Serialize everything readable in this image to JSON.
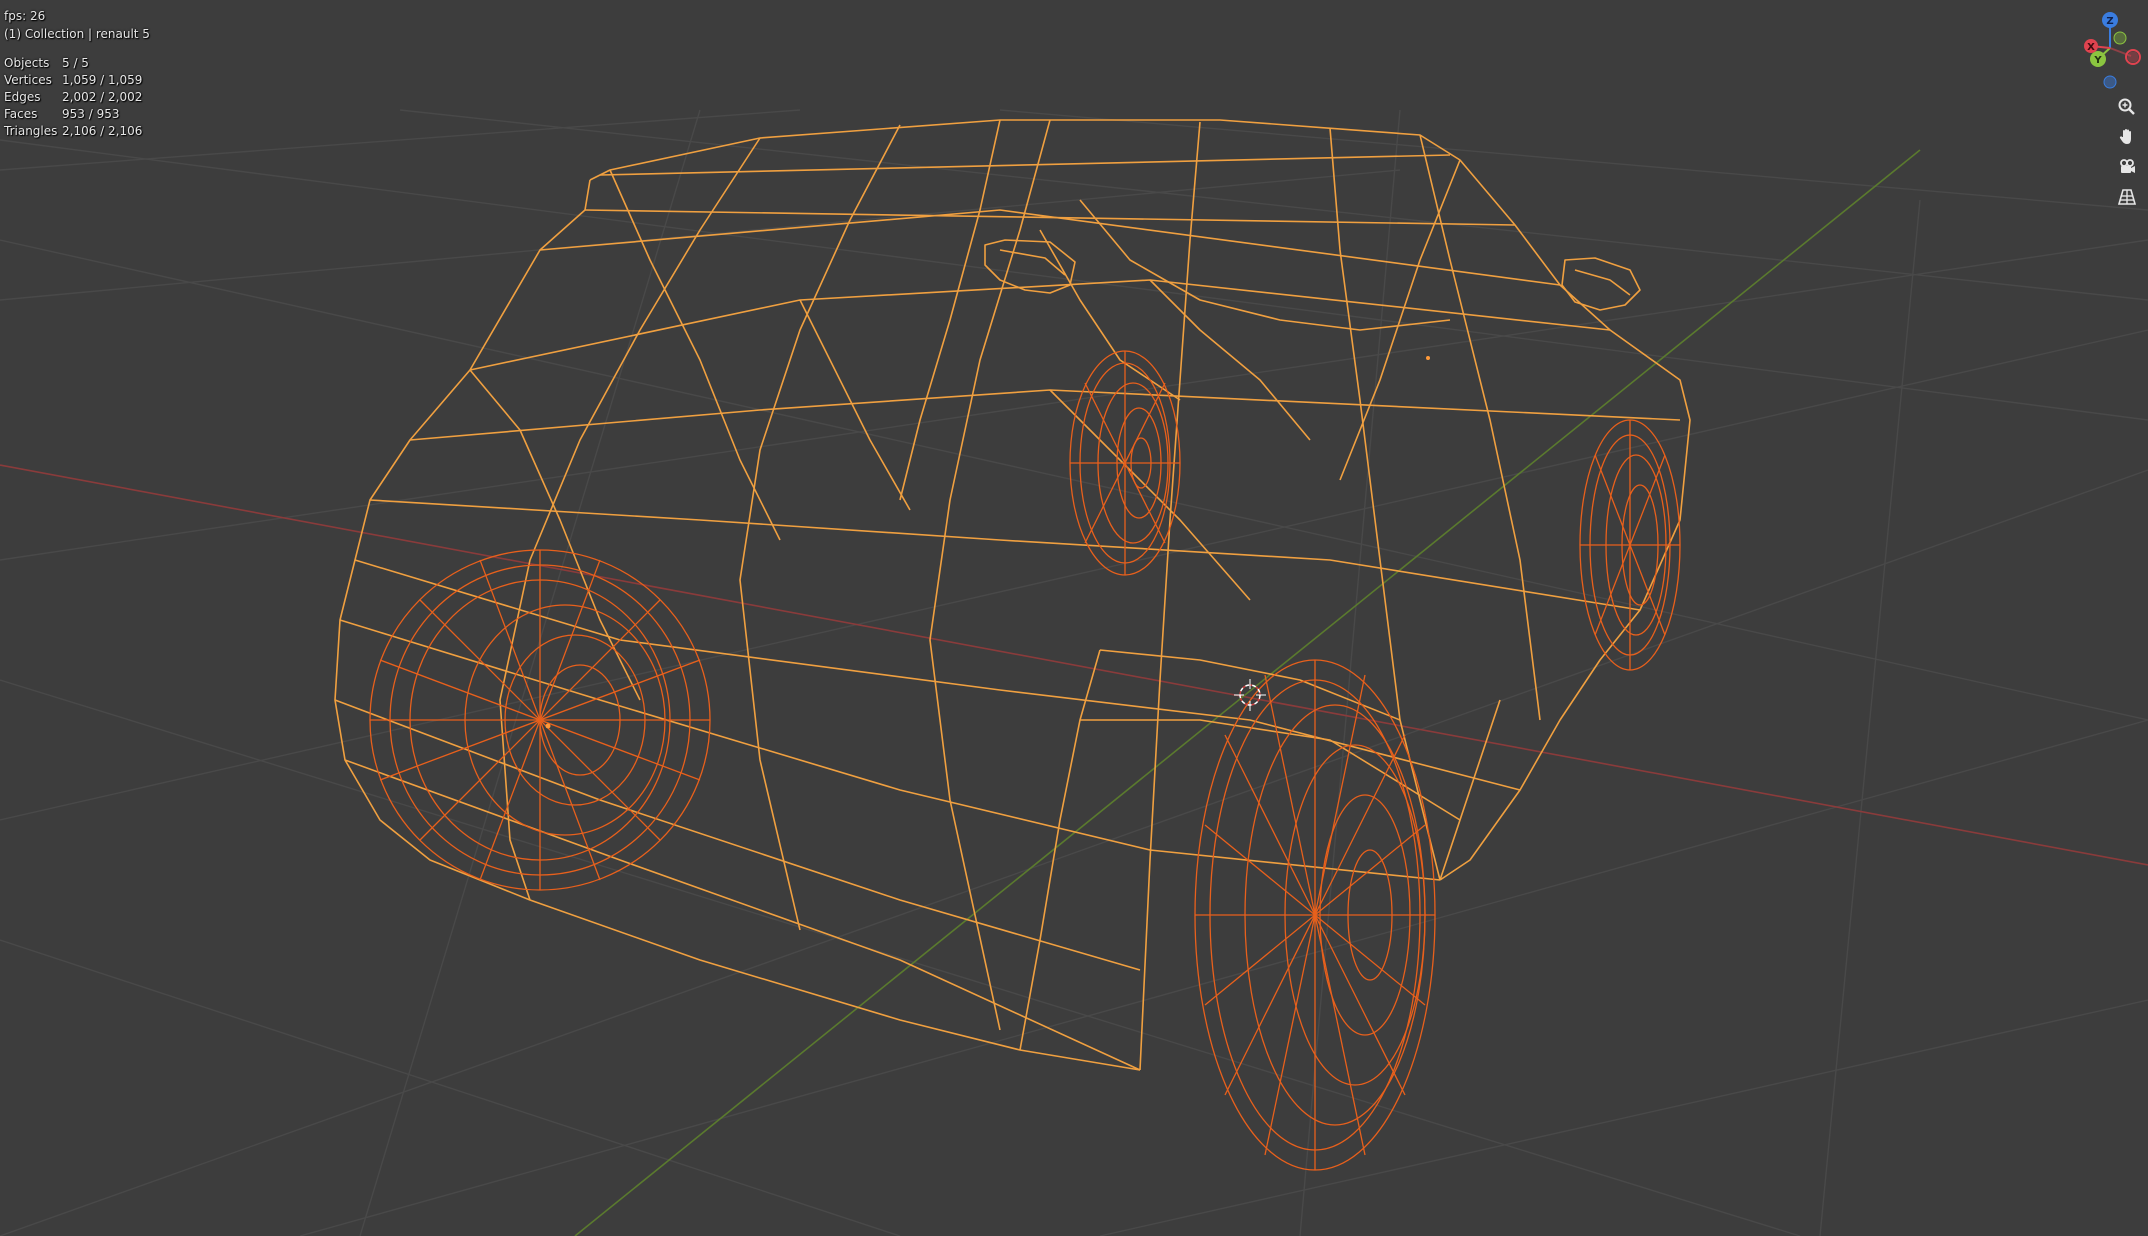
{
  "overlay": {
    "fps": "fps: 26",
    "collection": "(1) Collection | renault 5",
    "stats": [
      {
        "label": "Objects",
        "value": "5 / 5"
      },
      {
        "label": "Vertices",
        "value": "1,059 / 1,059"
      },
      {
        "label": "Edges",
        "value": "2,002 / 2,002"
      },
      {
        "label": "Faces",
        "value": "953 / 953"
      },
      {
        "label": "Triangles",
        "value": "2,106 / 2,106"
      }
    ]
  },
  "gizmo": {
    "axes": [
      "Z",
      "Y",
      "X"
    ],
    "colors": {
      "x": "#e0434f",
      "y": "#8bc540",
      "z": "#3a7de0"
    }
  },
  "tools": [
    {
      "name": "zoom-icon"
    },
    {
      "name": "hand-pan-icon"
    },
    {
      "name": "camera-icon"
    },
    {
      "name": "grid-perspective-icon"
    }
  ],
  "colors": {
    "background": "#3d3d3d",
    "grid": "#4a4a4a",
    "x_axis": "#8a3b3b",
    "y_axis": "#5a7a2e",
    "wire_body": "#f0a040",
    "wire_wheel": "#e8601c"
  }
}
